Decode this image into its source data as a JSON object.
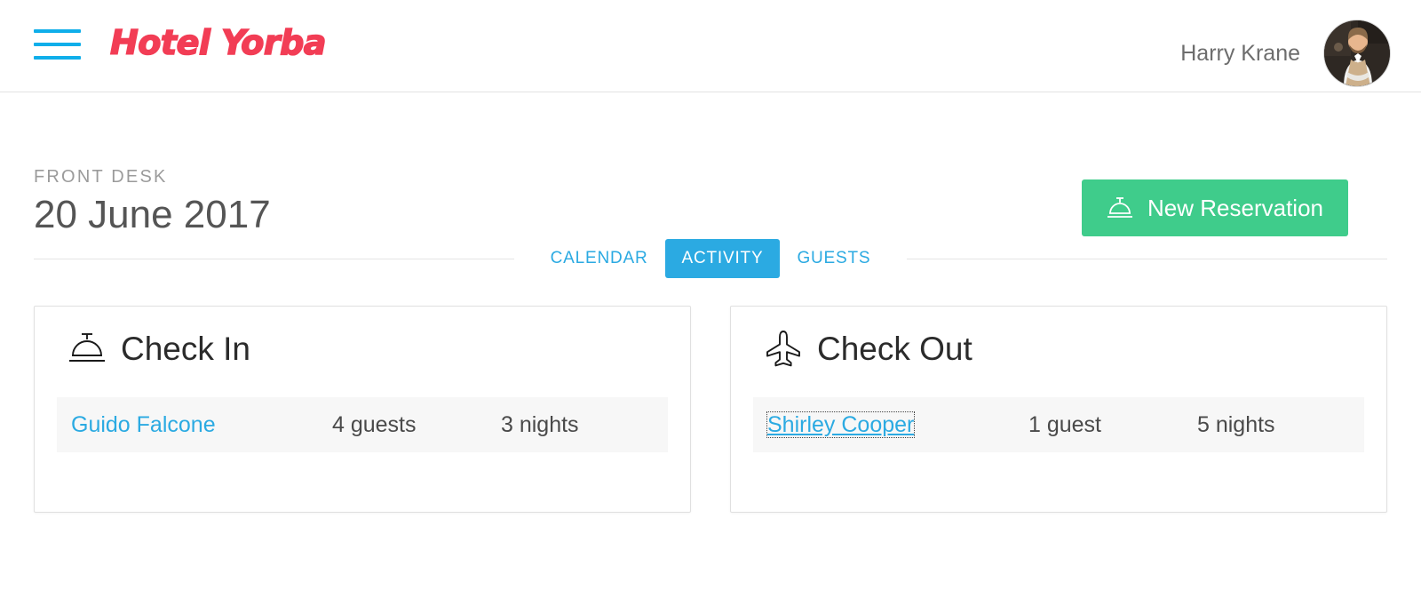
{
  "header": {
    "menu_icon": "hamburger-icon",
    "logo_text": "Hotel Yorba",
    "user_name": "Harry Krane",
    "avatar_icon": "user-avatar-photo",
    "accent_logo_color": "#F23D55",
    "accent_blue": "#2BAAE2"
  },
  "page": {
    "eyebrow": "FRONT DESK",
    "title": "20 June 2017",
    "new_reservation": {
      "label": "New Reservation",
      "icon": "bell-icon",
      "color": "#3FCC8B"
    }
  },
  "tabs": [
    {
      "label": "CALENDAR",
      "active": false
    },
    {
      "label": "ACTIVITY",
      "active": true
    },
    {
      "label": "GUESTS",
      "active": false
    }
  ],
  "cards": [
    {
      "title": "Check In",
      "icon": "bell-icon",
      "rows": [
        {
          "name": "Guido Falcone",
          "guests": "4 guests",
          "nights": "3 nights",
          "focused": false
        }
      ]
    },
    {
      "title": "Check Out",
      "icon": "airplane-icon",
      "rows": [
        {
          "name": "Shirley Cooper",
          "guests": "1 guest",
          "nights": "5 nights",
          "focused": true
        }
      ]
    }
  ]
}
